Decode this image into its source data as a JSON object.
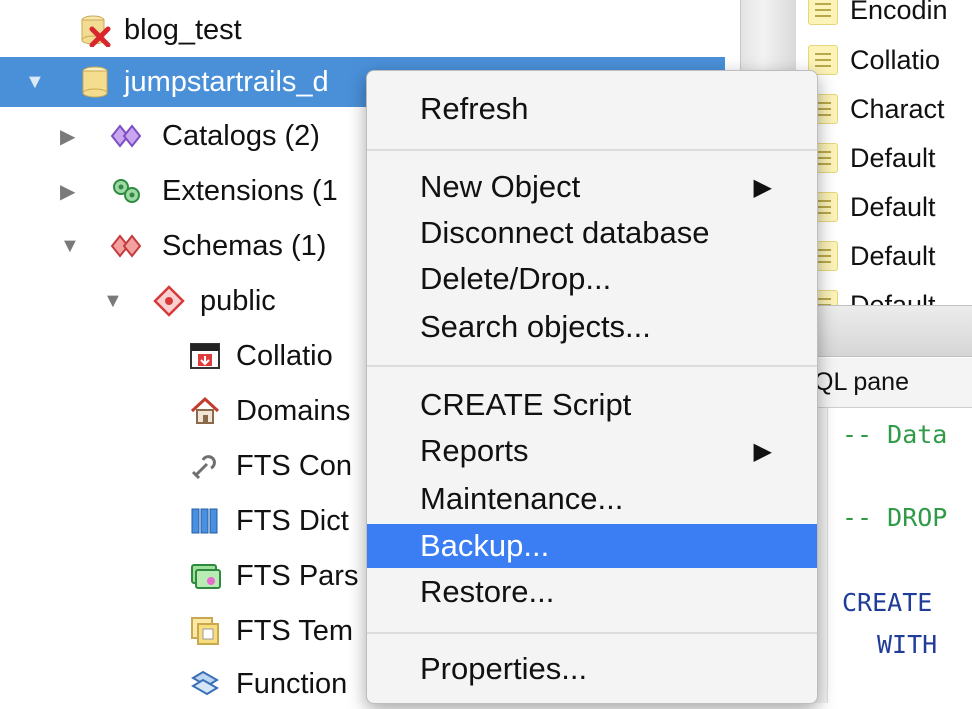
{
  "tree": {
    "items": [
      {
        "label": "blog_test",
        "icon": "database-error-icon"
      },
      {
        "label": "jumpstartrails_d",
        "icon": "database-icon",
        "expanded": true
      },
      {
        "label": "Catalogs (2)",
        "icon": "catalogs-icon"
      },
      {
        "label": "Extensions (1",
        "icon": "extensions-icon"
      },
      {
        "label": "Schemas (1)",
        "icon": "schemas-icon"
      },
      {
        "label": "public",
        "icon": "schema-public-icon"
      },
      {
        "label": "Collatio",
        "icon": "collations-icon"
      },
      {
        "label": "Domains",
        "icon": "domains-icon"
      },
      {
        "label": "FTS Con",
        "icon": "fts-configurations-icon"
      },
      {
        "label": "FTS Dict",
        "icon": "fts-dictionaries-icon"
      },
      {
        "label": "FTS Pars",
        "icon": "fts-parsers-icon"
      },
      {
        "label": "FTS Tem",
        "icon": "fts-templates-icon"
      },
      {
        "label": "Function",
        "icon": "functions-icon"
      }
    ]
  },
  "properties": {
    "rows": [
      "Encodin",
      "Collatio",
      "Charact",
      "Default",
      "Default",
      "Default",
      "Default"
    ]
  },
  "sql_pane": {
    "title": "QL pane",
    "lines": [
      "-- Data",
      "-- DROP",
      "CREATE",
      "WITH"
    ]
  },
  "context_menu": {
    "items": [
      {
        "label": "Refresh"
      },
      {
        "label": "New Object",
        "submenu": true
      },
      {
        "label": "Disconnect database"
      },
      {
        "label": "Delete/Drop..."
      },
      {
        "label": "Search objects..."
      },
      {
        "label": "CREATE Script"
      },
      {
        "label": "Reports",
        "submenu": true
      },
      {
        "label": "Maintenance..."
      },
      {
        "label": "Backup...",
        "highlighted": true
      },
      {
        "label": "Restore..."
      },
      {
        "label": "Properties..."
      }
    ],
    "submenu_glyph": "▶"
  },
  "colors": {
    "selection": "#4a90d9",
    "menu_highlight": "#3b7ef3",
    "sql_comment": "#2f9a47",
    "sql_keyword": "#1f3c99"
  }
}
